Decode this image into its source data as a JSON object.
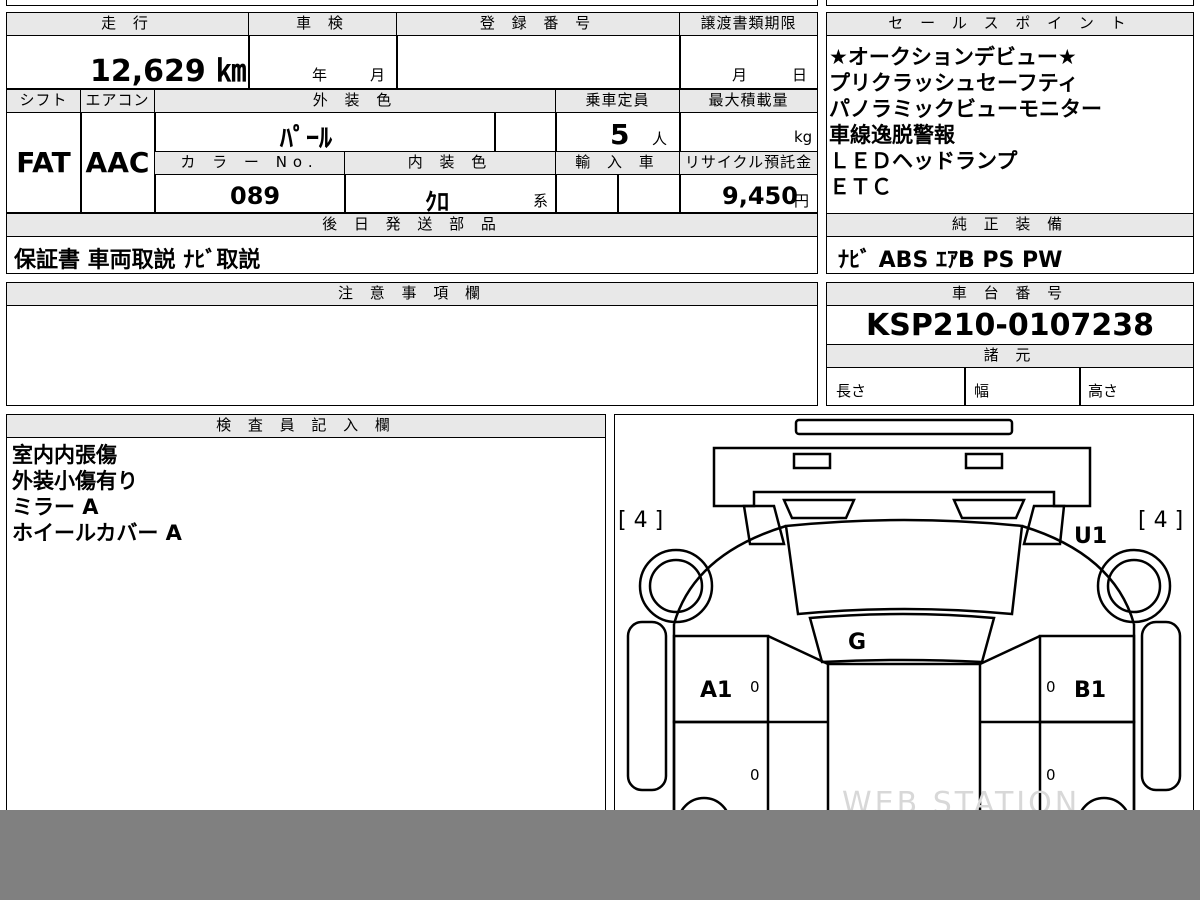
{
  "top": {
    "mileage_label": "走 行",
    "mileage_value": "12,629 ㎞",
    "inspection_label": "車 検",
    "inspection_year": "年",
    "inspection_month": "月",
    "registration_label": "登 録 番 号",
    "transfer_label": "譲渡書類期限",
    "transfer_month": "月",
    "transfer_day": "日"
  },
  "specs": {
    "shift_label": "シフト",
    "shift_value": "FAT",
    "aircon_label": "エアコン",
    "aircon_value": "AAC",
    "exterior_label": "外 装 色",
    "exterior_value": "ﾊﾟｰﾙ",
    "capacity_label": "乗車定員",
    "capacity_value": "5",
    "capacity_unit": "人",
    "maxload_label": "最大積載量",
    "maxload_unit": "kg",
    "color_no_label": "カ ラ ー No.",
    "color_no_value": "089",
    "interior_label": "内 装 色",
    "interior_value": "ｸﾛ",
    "interior_suffix": "系",
    "import_label": "輸 入 車",
    "recycle_label": "リサイクル預託金",
    "recycle_value": "9,450",
    "recycle_unit": "円"
  },
  "later_parts": {
    "label": "後 日 発 送 部 品",
    "value": "保証書 車両取説 ﾅﾋﾞ取説"
  },
  "sales_points": {
    "label": "セ ー ル ス ポ イ ン ト",
    "lines": [
      "★オークションデビュー★",
      "プリクラッシュセーフティ",
      "パノラミックビューモニター",
      "車線逸脱警報",
      "ＬＥＤヘッドランプ",
      "ＥＴＣ"
    ]
  },
  "genuine_equipment": {
    "label": "純 正 装 備",
    "value": "ﾅﾋﾞ ABS ｴｱB PS PW"
  },
  "notes": {
    "label": "注 意 事 項 欄"
  },
  "chassis": {
    "label": "車 台 番 号",
    "value": "KSP210-0107238"
  },
  "dimensions": {
    "label": "諸 元",
    "length": "長さ",
    "width": "幅",
    "height": "高さ"
  },
  "inspector": {
    "label": "検 査 員 記 入 欄",
    "lines": [
      "室内内張傷",
      "外装小傷有り",
      "ミラー A",
      "ホイールカバー A"
    ]
  },
  "diagram": {
    "tire_left": "[ 4 ]",
    "tire_right": "[ 4 ]",
    "u1": "U1",
    "g": "G",
    "a1": "A1",
    "b1": "B1",
    "zero": "0",
    "watermark": "WEB STATION"
  }
}
